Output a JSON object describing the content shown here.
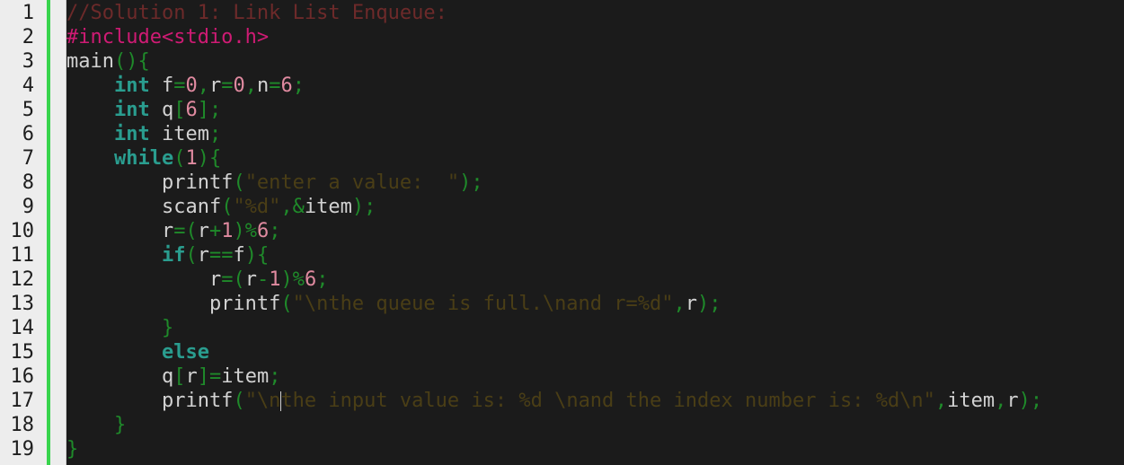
{
  "editor": {
    "lines": [
      {
        "num": "1",
        "tokens": [
          {
            "t": "//Solution 1: Link List Enqueue:",
            "c": "t-comment"
          }
        ]
      },
      {
        "num": "2",
        "tokens": [
          {
            "t": "#include<stdio.h>",
            "c": "t-pre"
          }
        ]
      },
      {
        "num": "3",
        "tokens": [
          {
            "t": "main",
            "c": "t-id"
          },
          {
            "t": "(){",
            "c": "t-op"
          }
        ]
      },
      {
        "num": "4",
        "tokens": [
          {
            "t": "    ",
            "c": "t-id"
          },
          {
            "t": "int",
            "c": "t-kw"
          },
          {
            "t": " f",
            "c": "t-id"
          },
          {
            "t": "=",
            "c": "t-op"
          },
          {
            "t": "0",
            "c": "t-num"
          },
          {
            "t": ",",
            "c": "t-op"
          },
          {
            "t": "r",
            "c": "t-id"
          },
          {
            "t": "=",
            "c": "t-op"
          },
          {
            "t": "0",
            "c": "t-num"
          },
          {
            "t": ",",
            "c": "t-op"
          },
          {
            "t": "n",
            "c": "t-id"
          },
          {
            "t": "=",
            "c": "t-op"
          },
          {
            "t": "6",
            "c": "t-num"
          },
          {
            "t": ";",
            "c": "t-op"
          }
        ]
      },
      {
        "num": "5",
        "tokens": [
          {
            "t": "    ",
            "c": "t-id"
          },
          {
            "t": "int",
            "c": "t-kw"
          },
          {
            "t": " q",
            "c": "t-id"
          },
          {
            "t": "[",
            "c": "t-op"
          },
          {
            "t": "6",
            "c": "t-num"
          },
          {
            "t": "];",
            "c": "t-op"
          }
        ]
      },
      {
        "num": "6",
        "tokens": [
          {
            "t": "    ",
            "c": "t-id"
          },
          {
            "t": "int",
            "c": "t-kw"
          },
          {
            "t": " item",
            "c": "t-id"
          },
          {
            "t": ";",
            "c": "t-op"
          }
        ]
      },
      {
        "num": "7",
        "tokens": [
          {
            "t": "    ",
            "c": "t-id"
          },
          {
            "t": "while",
            "c": "t-kw"
          },
          {
            "t": "(",
            "c": "t-op"
          },
          {
            "t": "1",
            "c": "t-num"
          },
          {
            "t": "){",
            "c": "t-op"
          }
        ]
      },
      {
        "num": "8",
        "tokens": [
          {
            "t": "        printf",
            "c": "t-id"
          },
          {
            "t": "(",
            "c": "t-op"
          },
          {
            "t": "\"enter a value:  \"",
            "c": "t-str"
          },
          {
            "t": ");",
            "c": "t-op"
          }
        ]
      },
      {
        "num": "9",
        "tokens": [
          {
            "t": "        scanf",
            "c": "t-id"
          },
          {
            "t": "(",
            "c": "t-op"
          },
          {
            "t": "\"%d\"",
            "c": "t-str"
          },
          {
            "t": ",&",
            "c": "t-op"
          },
          {
            "t": "item",
            "c": "t-id"
          },
          {
            "t": ");",
            "c": "t-op"
          }
        ]
      },
      {
        "num": "10",
        "tokens": [
          {
            "t": "        r",
            "c": "t-id"
          },
          {
            "t": "=(",
            "c": "t-op"
          },
          {
            "t": "r",
            "c": "t-id"
          },
          {
            "t": "+",
            "c": "t-op"
          },
          {
            "t": "1",
            "c": "t-num"
          },
          {
            "t": ")%",
            "c": "t-op"
          },
          {
            "t": "6",
            "c": "t-num"
          },
          {
            "t": ";",
            "c": "t-op"
          }
        ]
      },
      {
        "num": "11",
        "tokens": [
          {
            "t": "        ",
            "c": "t-id"
          },
          {
            "t": "if",
            "c": "t-kw"
          },
          {
            "t": "(",
            "c": "t-op"
          },
          {
            "t": "r",
            "c": "t-id"
          },
          {
            "t": "==",
            "c": "t-op"
          },
          {
            "t": "f",
            "c": "t-id"
          },
          {
            "t": "){",
            "c": "t-op"
          }
        ]
      },
      {
        "num": "12",
        "tokens": [
          {
            "t": "            r",
            "c": "t-id"
          },
          {
            "t": "=(",
            "c": "t-op"
          },
          {
            "t": "r",
            "c": "t-id"
          },
          {
            "t": "-",
            "c": "t-op"
          },
          {
            "t": "1",
            "c": "t-num"
          },
          {
            "t": ")%",
            "c": "t-op"
          },
          {
            "t": "6",
            "c": "t-num"
          },
          {
            "t": ";",
            "c": "t-op"
          }
        ]
      },
      {
        "num": "13",
        "tokens": [
          {
            "t": "            printf",
            "c": "t-id"
          },
          {
            "t": "(",
            "c": "t-op"
          },
          {
            "t": "\"\\nthe queue is full.\\nand r=%d\"",
            "c": "t-str"
          },
          {
            "t": ",",
            "c": "t-op"
          },
          {
            "t": "r",
            "c": "t-id"
          },
          {
            "t": ");",
            "c": "t-op"
          }
        ]
      },
      {
        "num": "14",
        "tokens": [
          {
            "t": "        ",
            "c": "t-id"
          },
          {
            "t": "}",
            "c": "t-op"
          }
        ]
      },
      {
        "num": "15",
        "tokens": [
          {
            "t": "        ",
            "c": "t-id"
          },
          {
            "t": "else",
            "c": "t-kw"
          }
        ]
      },
      {
        "num": "16",
        "tokens": [
          {
            "t": "        q",
            "c": "t-id"
          },
          {
            "t": "[",
            "c": "t-op"
          },
          {
            "t": "r",
            "c": "t-id"
          },
          {
            "t": "]=",
            "c": "t-op"
          },
          {
            "t": "item",
            "c": "t-id"
          },
          {
            "t": ";",
            "c": "t-op"
          }
        ]
      },
      {
        "num": "17",
        "tokens": [
          {
            "t": "        printf",
            "c": "t-id"
          },
          {
            "t": "(",
            "c": "t-op"
          },
          {
            "t": "\"\\n",
            "c": "t-str"
          },
          {
            "t": "",
            "c": "caret"
          },
          {
            "t": "the input value is: %d \\nand the index number is: %d\\n\"",
            "c": "t-str"
          },
          {
            "t": ",",
            "c": "t-op"
          },
          {
            "t": "item",
            "c": "t-id"
          },
          {
            "t": ",",
            "c": "t-op"
          },
          {
            "t": "r",
            "c": "t-id"
          },
          {
            "t": ");",
            "c": "t-op"
          }
        ]
      },
      {
        "num": "18",
        "tokens": [
          {
            "t": "    ",
            "c": "t-id"
          },
          {
            "t": "}",
            "c": "t-op"
          }
        ]
      },
      {
        "num": "19",
        "tokens": [
          {
            "t": "}",
            "c": "t-op"
          }
        ]
      }
    ]
  }
}
